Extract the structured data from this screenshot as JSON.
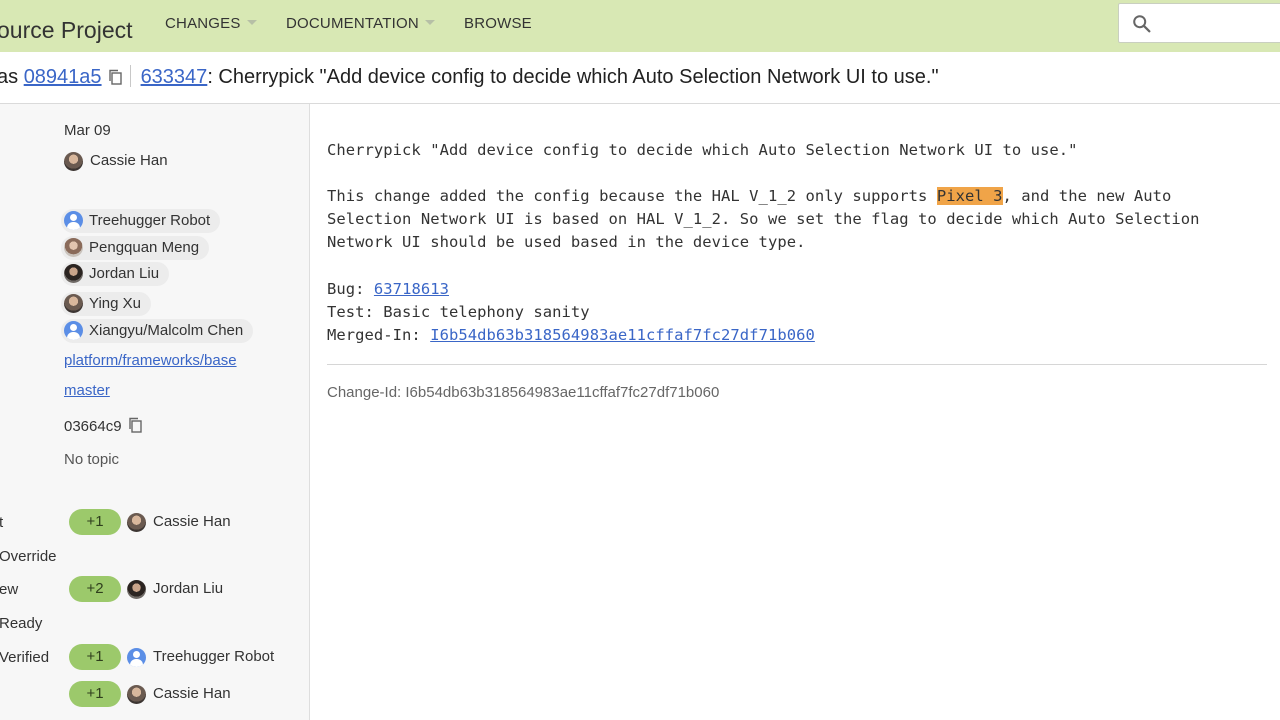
{
  "topbar": {
    "brand": "ource Project",
    "nav": [
      {
        "label": "CHANGES"
      },
      {
        "label": "DOCUMENTATION"
      },
      {
        "label": "BROWSE"
      }
    ],
    "search": {
      "placeholder": ""
    }
  },
  "change_header": {
    "prefix": "as",
    "commit": "08941a5",
    "change_number": "633347",
    "subject": ": Cherrypick \"Add device config to decide which Auto Selection Network UI to use.\""
  },
  "info": {
    "date": "Mar 09",
    "owner": "Cassie Han",
    "reviewers": [
      "Treehugger Robot",
      "Pengquan Meng",
      "Jordan Liu",
      "Ying Xu",
      "Xiangyu/Malcolm Chen"
    ],
    "project": "platform/frameworks/base",
    "branch": "master",
    "parent_commit": "03664c9",
    "topic": "No topic"
  },
  "labels": [
    {
      "name": "t",
      "score": "+1",
      "voter": "Cassie Han"
    },
    {
      "name": "Override",
      "score": "",
      "voter": ""
    },
    {
      "name": "ew",
      "score": "+2",
      "voter": "Jordan Liu"
    },
    {
      "name": "Ready",
      "score": "",
      "voter": ""
    },
    {
      "name": "Verified",
      "score": "+1",
      "voter": "Treehugger Robot"
    },
    {
      "name": "",
      "score": "+1",
      "voter": "Cassie Han"
    }
  ],
  "message": {
    "line1": "Cherrypick \"Add device config to decide which Auto Selection Network UI to use.\"",
    "para_before_hl": "This change added the config because the HAL V_1_2 only supports ",
    "highlight": "Pixel 3",
    "para_after_hl": ", and the new Auto",
    "para_line2": "Selection Network UI is based on HAL V_1_2. So we set the flag to decide which Auto Selection",
    "para_line3": "Network UI should be used based in the device type.",
    "bug_label": "Bug: ",
    "bug_id": "63718613",
    "test_line": "Test: Basic telephony sanity",
    "merged_label": "Merged-In: ",
    "merged_id": "I6b54db63b318564983ae11cffaf7fc27df71b060",
    "change_id": "Change-Id: I6b54db63b318564983ae11cffaf7fc27df71b060"
  },
  "icons": {
    "search": "search-icon",
    "copy": "copy-icon",
    "caret": "caret-down-icon"
  },
  "colors": {
    "topbar": "#d8e8b4",
    "link": "#3a66c7",
    "vote": "#9cc96b",
    "highlight": "#f0a448"
  }
}
